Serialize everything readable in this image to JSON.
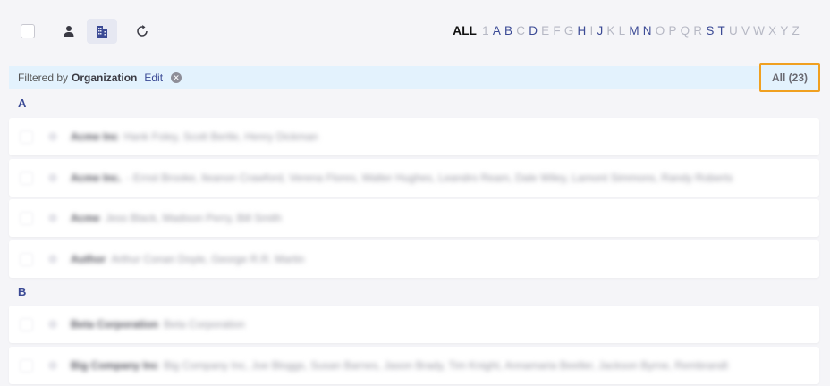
{
  "toolbar": {
    "alphabet": {
      "all_label": "ALL",
      "letters": [
        {
          "ch": "1",
          "active": false
        },
        {
          "ch": "A",
          "active": true
        },
        {
          "ch": "B",
          "active": true
        },
        {
          "ch": "C",
          "active": false
        },
        {
          "ch": "D",
          "active": true
        },
        {
          "ch": "E",
          "active": false
        },
        {
          "ch": "F",
          "active": false
        },
        {
          "ch": "G",
          "active": false
        },
        {
          "ch": "H",
          "active": true
        },
        {
          "ch": "I",
          "active": false
        },
        {
          "ch": "J",
          "active": true
        },
        {
          "ch": "K",
          "active": false
        },
        {
          "ch": "L",
          "active": false
        },
        {
          "ch": "M",
          "active": true
        },
        {
          "ch": "N",
          "active": true
        },
        {
          "ch": "O",
          "active": false
        },
        {
          "ch": "P",
          "active": false
        },
        {
          "ch": "Q",
          "active": false
        },
        {
          "ch": "R",
          "active": false
        },
        {
          "ch": "S",
          "active": true
        },
        {
          "ch": "T",
          "active": true
        },
        {
          "ch": "U",
          "active": false
        },
        {
          "ch": "V",
          "active": false
        },
        {
          "ch": "W",
          "active": false
        },
        {
          "ch": "X",
          "active": false
        },
        {
          "ch": "Y",
          "active": false
        },
        {
          "ch": "Z",
          "active": false
        }
      ]
    }
  },
  "filter": {
    "prefix": "Filtered by",
    "field": "Organization",
    "edit_label": "Edit",
    "clear_glyph": "✕",
    "count_label": "All (23)"
  },
  "sections": [
    {
      "letter": "A",
      "rows": [
        {
          "name": "Acme Inc",
          "members": "Hank Foley, Scott Bertle, Henry Dickman"
        },
        {
          "name": "Acme Inc.",
          "members": "- Ernst Brooke, Ileanon Crawford, Verena Flores, Walter Hughes, Leandro Ream, Dale Wiley, Lamont Simmons, Randy Roberts"
        },
        {
          "name": "Acme",
          "members": "Jess Black, Madison Perry, Bill Smith"
        },
        {
          "name": "Author",
          "members": "Arthur Conan Doyle, George R.R. Martin"
        }
      ]
    },
    {
      "letter": "B",
      "rows": [
        {
          "name": "Beta Corporation",
          "members": "Beta Corporation"
        },
        {
          "name": "Big Company Inc",
          "members": "Big Company Inc, Joe Bloggs, Susan Barnes, Jason Brady, Tim Knight, Annamaria Beeller, Jackson Byrne, Rembrandt"
        }
      ]
    }
  ],
  "colors": {
    "accent": "#3b4a95",
    "highlight_border": "#f0a020",
    "filter_bg": "#e3f2fd"
  }
}
